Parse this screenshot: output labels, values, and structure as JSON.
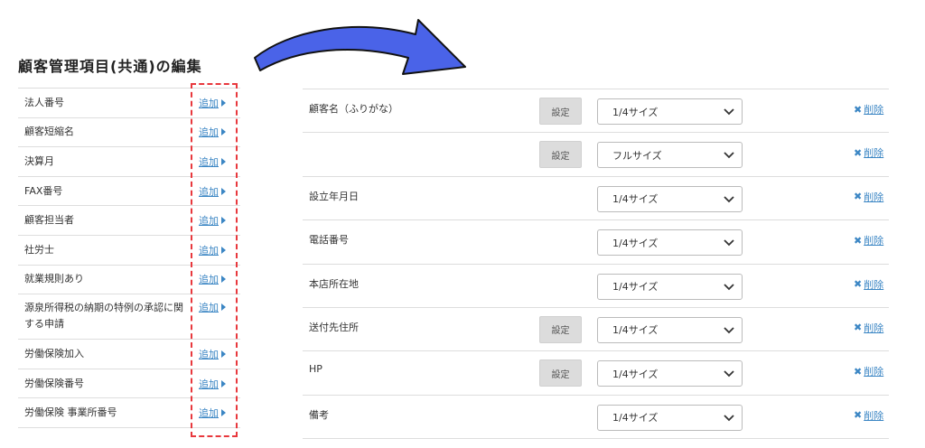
{
  "page": {
    "title": "顧客管理項目(共通)の編集"
  },
  "left_items": [
    {
      "label": "法人番号",
      "add": "追加"
    },
    {
      "label": "顧客短縮名",
      "add": "追加"
    },
    {
      "label": "決算月",
      "add": "追加"
    },
    {
      "label": "FAX番号",
      "add": "追加"
    },
    {
      "label": "顧客担当者",
      "add": "追加"
    },
    {
      "label": "社労士",
      "add": "追加"
    },
    {
      "label": "就業規則あり",
      "add": "追加"
    },
    {
      "label": "源泉所得税の納期の特例の承認に関する申請",
      "add": "追加"
    },
    {
      "label": "労働保険加入",
      "add": "追加"
    },
    {
      "label": "労働保険番号",
      "add": "追加"
    },
    {
      "label": "労働保険 事業所番号",
      "add": "追加"
    }
  ],
  "right_rows": [
    {
      "label": "顧客名（ふりがな）",
      "setting": "設定",
      "size": "1/4サイズ",
      "delete": "削除"
    },
    {
      "label": "",
      "setting": "設定",
      "size": "フルサイズ",
      "delete": "削除"
    },
    {
      "label": "設立年月日",
      "setting": "",
      "size": "1/4サイズ",
      "delete": "削除"
    },
    {
      "label": "電話番号",
      "setting": "",
      "size": "1/4サイズ",
      "delete": "削除"
    },
    {
      "label": "本店所在地",
      "setting": "",
      "size": "1/4サイズ",
      "delete": "削除"
    },
    {
      "label": "送付先住所",
      "setting": "設定",
      "size": "1/4サイズ",
      "delete": "削除"
    },
    {
      "label": "HP",
      "setting": "設定",
      "size": "1/4サイズ",
      "delete": "削除"
    },
    {
      "label": "備考",
      "setting": "",
      "size": "1/4サイズ",
      "delete": "削除"
    }
  ],
  "colors": {
    "accent_link": "#3b86c4",
    "highlight_dash": "#e8383d",
    "arrow_fill": "#4a63e8"
  },
  "icons": {
    "add": "triangle-right-icon",
    "delete": "x-icon",
    "select": "chevron-down-icon",
    "annotation": "curved-arrow-icon"
  }
}
